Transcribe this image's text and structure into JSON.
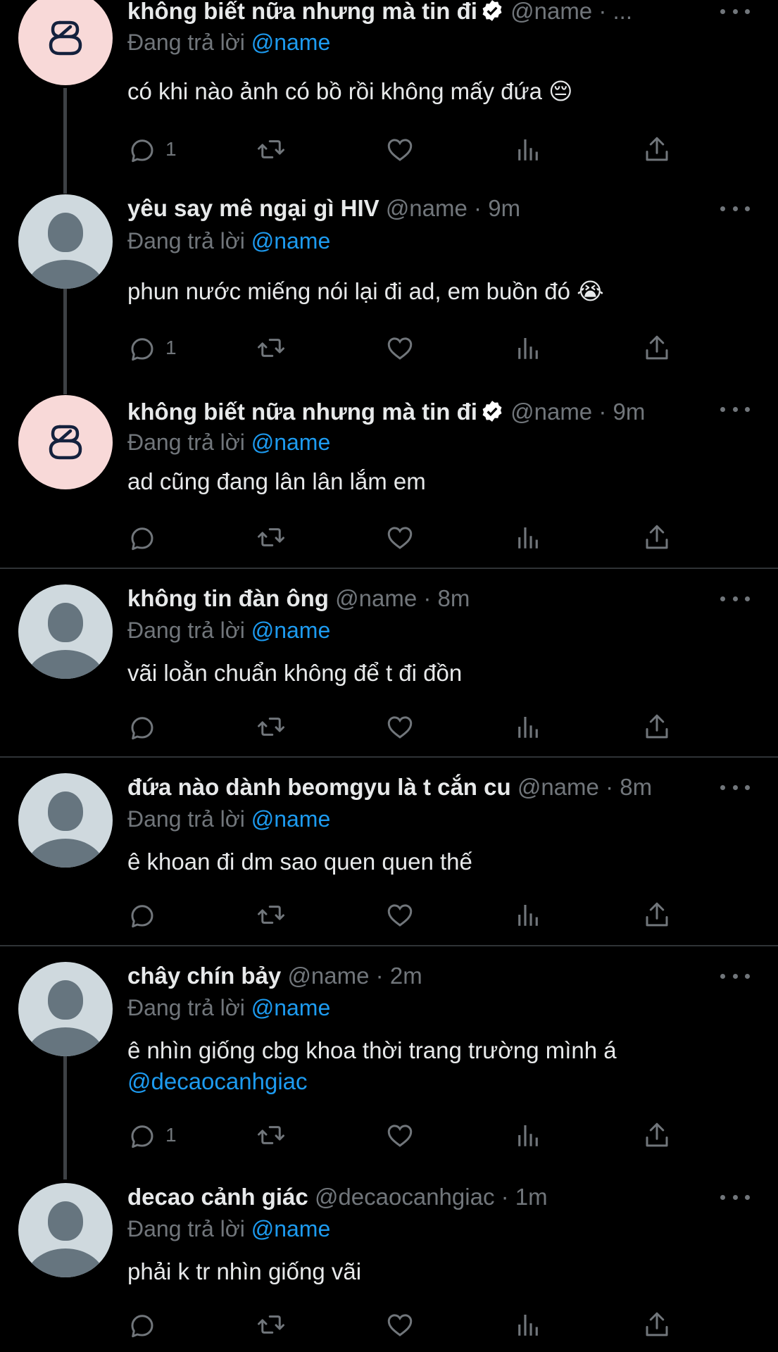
{
  "replying_label": "Đang trả lời",
  "tweets": [
    {
      "name": "không biết nữa nhưng mà tin đi",
      "handle": "@name",
      "separator": "·",
      "time": "...",
      "replying_to": "@name",
      "text": "có khi nào ảnh có bồ rồi không mấy đứa 😔",
      "reply_count": "1",
      "avatar": "brand-logo",
      "verified": true
    },
    {
      "name": "yêu say mê ngại gì HIV",
      "handle": "@name",
      "separator": "·",
      "time": "9m",
      "replying_to": "@name",
      "text": "phun nước miếng nói lại đi ad, em buồn đó 😭",
      "reply_count": "1",
      "avatar": "default-profile"
    },
    {
      "name": "không biết nữa nhưng mà tin đi",
      "handle": "@name",
      "separator": "·",
      "time": "9m",
      "replying_to": "@name",
      "text": "ad cũng đang lân lân lắm em",
      "reply_count": "",
      "avatar": "brand-logo",
      "verified": true
    },
    {
      "name": "không tin đàn ông",
      "handle": "@name",
      "separator": "·",
      "time": "8m",
      "replying_to": "@name",
      "text": "vãi loằn chuẩn không để t đi đồn",
      "reply_count": "",
      "avatar": "default-profile"
    },
    {
      "name": "đứa nào dành beomgyu là t cắn cu",
      "handle": "@name",
      "separator": "·",
      "time": "8m",
      "replying_to": "@name",
      "text": "ê khoan đi dm sao quen quen thế",
      "reply_count": "",
      "avatar": "default-profile"
    },
    {
      "name": "chây chín bảy",
      "handle": "@name",
      "separator": "·",
      "time": "2m",
      "replying_to": "@name",
      "text": "ê nhìn giống cbg khoa thời trang trường mình á",
      "text_mention": "@decaocanhgiac",
      "reply_count": "1",
      "avatar": "default-profile"
    },
    {
      "name": "decao cảnh giác",
      "handle": "@decaocanhgiac",
      "separator": "·",
      "time": "1m",
      "replying_to": "@name",
      "text": "phải k tr nhìn giống vãi",
      "reply_count": "",
      "avatar": "default-profile"
    }
  ],
  "colors": {
    "background": "#000000",
    "text": "#e7e9ea",
    "muted": "#71767b",
    "link": "#1d9bf0",
    "divider": "#2f3336",
    "thread_line": "#3d4145",
    "brand_avatar_bg": "#f8d9d8",
    "verified_badge": "#ffffff"
  }
}
